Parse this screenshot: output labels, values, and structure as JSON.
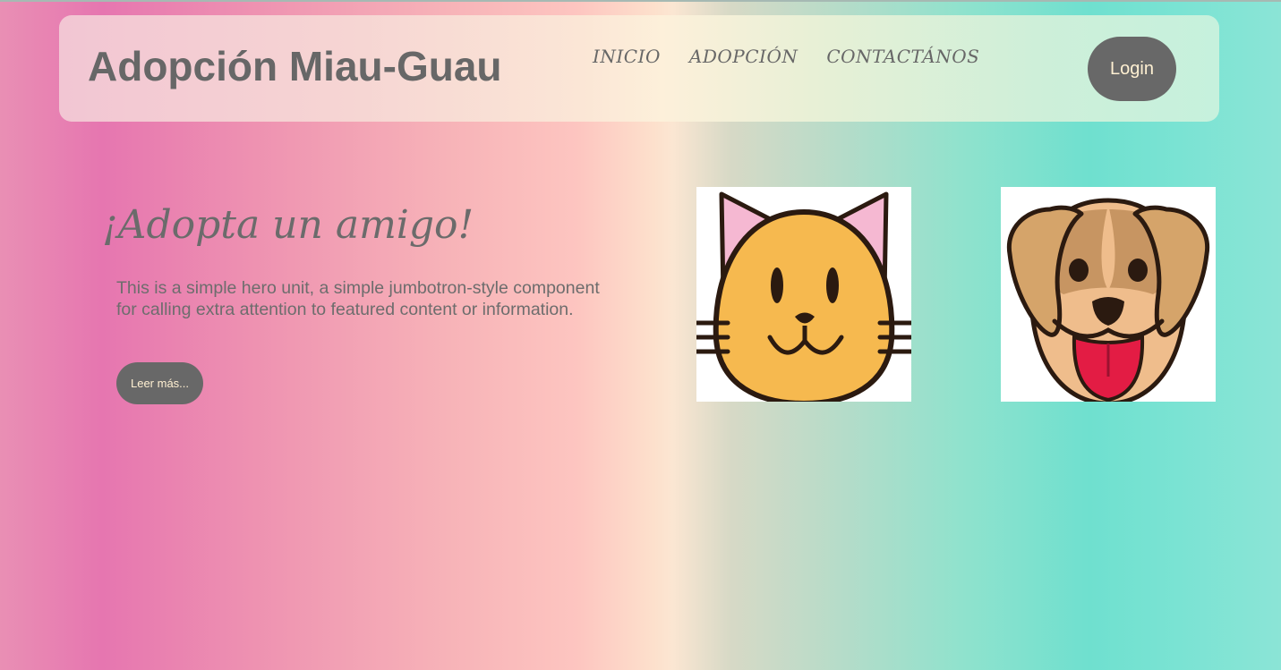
{
  "brand": {
    "title": "Adopción Miau-Guau"
  },
  "nav": {
    "items": [
      {
        "label": "INICIO"
      },
      {
        "label": "ADOPCIÓN"
      },
      {
        "label": "CONTACTÁNOS"
      }
    ],
    "login_label": "Login"
  },
  "hero": {
    "title": "¡Adopta un amigo!",
    "text": "This is a simple hero unit, a simple jumbotron-style component for calling extra attention to featured content or information.",
    "button_label": "Leer más..."
  },
  "images": {
    "cat_icon": "cat-face-icon",
    "dog_icon": "dog-face-icon"
  },
  "colors": {
    "button_bg": "#686868",
    "button_text": "#fff0d2",
    "text": "#676767"
  }
}
